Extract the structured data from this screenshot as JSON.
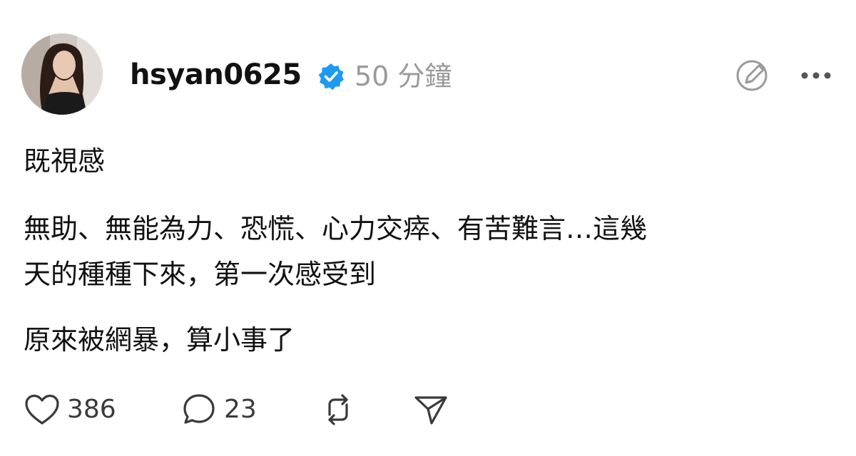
{
  "post": {
    "author": {
      "username": "hsyan0625",
      "avatar": "avatar-photo",
      "verified": true,
      "verified_icon": "verified-badge-icon",
      "verified_color": "#1d9bf0"
    },
    "time_ago": "50 分鐘",
    "header_actions": {
      "edit_icon": "edit-circle-icon",
      "more_icon": "more-dots-icon"
    },
    "paragraphs": [
      "既視感",
      "無助、無能為力、恐慌、心力交瘁、有苦難言…這幾",
      "天的種種下來，第一次感受到",
      "原來被網暴，算小事了"
    ],
    "stats": {
      "likes": "386",
      "comments": "23"
    },
    "actions": {
      "like_icon": "heart-icon",
      "comment_icon": "comment-bubble-icon",
      "repost_icon": "repost-icon",
      "share_icon": "send-icon"
    }
  },
  "colors": {
    "text": "#111111",
    "muted": "#9a9a9a",
    "icon": "#3a3a3a",
    "verified": "#1d9bf0"
  }
}
